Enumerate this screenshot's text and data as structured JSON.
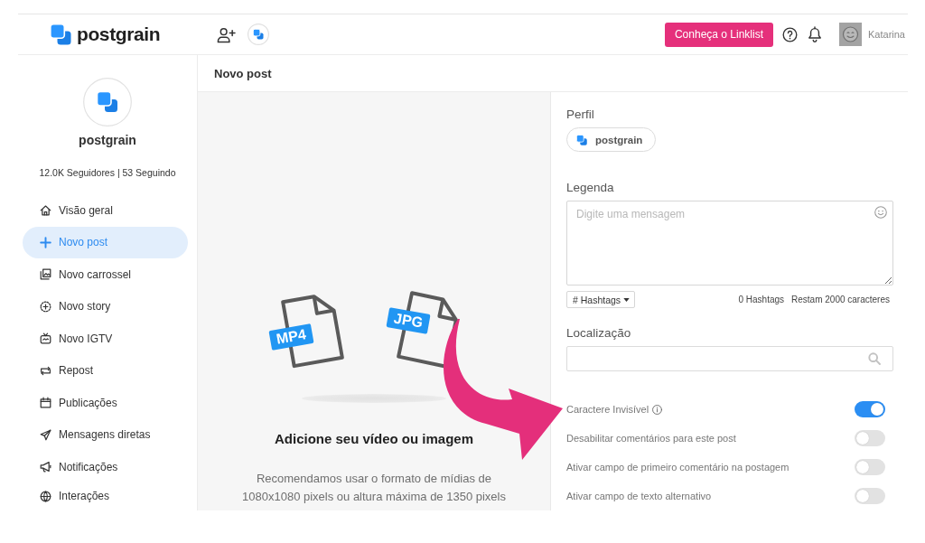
{
  "header": {
    "logo_text": "postgrain",
    "promo_button": "Conheça o Linklist",
    "user_name": "Katarina"
  },
  "sidebar": {
    "profile_name": "postgrain",
    "stats": "12.0K Seguidores | 53 Seguindo",
    "items": [
      {
        "label": "Visão geral",
        "selected": false
      },
      {
        "label": "Novo post",
        "selected": true
      },
      {
        "label": "Novo carrossel",
        "selected": false
      },
      {
        "label": "Novo story",
        "selected": false
      },
      {
        "label": "Novo IGTV",
        "selected": false
      },
      {
        "label": "Repost",
        "selected": false
      },
      {
        "label": "Publicações",
        "selected": false
      },
      {
        "label": "Mensagens diretas",
        "selected": false
      },
      {
        "label": "Notificações",
        "selected": false
      },
      {
        "label": "Interações",
        "selected": false
      }
    ]
  },
  "page_title": "Novo post",
  "upload": {
    "formats": [
      "MP4",
      "JPG"
    ],
    "title": "Adicione seu vídeo ou imagem",
    "hint": "Recomendamos usar o formato de mídias de 1080x1080 pixels ou altura máxima de 1350 pixels"
  },
  "form": {
    "profile": {
      "label": "Perfil",
      "value": "postgrain"
    },
    "caption": {
      "label": "Legenda",
      "placeholder": "Digite uma mensagem",
      "hashtags_button": "# Hashtags",
      "hashtag_count": "0 Hashtags",
      "remaining": "Restam 2000 caracteres"
    },
    "location": {
      "label": "Localização"
    },
    "options": [
      {
        "label": "Caractere Invisível",
        "info": true,
        "on": true
      },
      {
        "label": "Desabilitar comentários para este post",
        "info": false,
        "on": false
      },
      {
        "label": "Ativar campo de primeiro comentário na postagem",
        "info": false,
        "on": false
      },
      {
        "label": "Ativar campo de texto alternativo",
        "info": false,
        "on": false
      }
    ]
  }
}
